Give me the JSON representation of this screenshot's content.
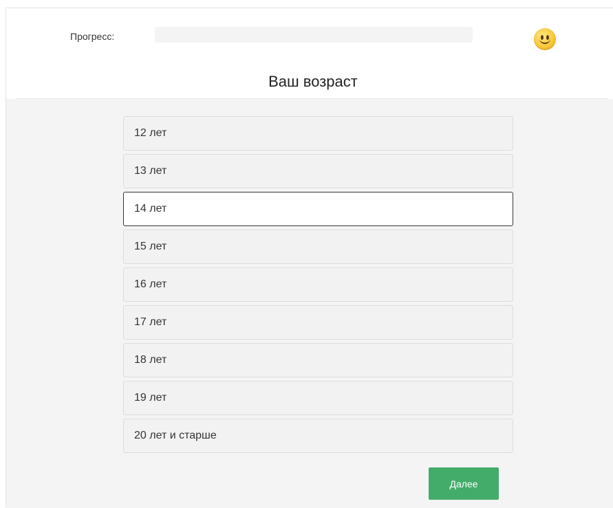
{
  "header": {
    "progress_label": "Прогресс:",
    "progress_value": 0,
    "status_icon": "smiley-face-icon"
  },
  "question": {
    "title": "Ваш возраст"
  },
  "options": [
    {
      "label": "12 лет",
      "selected": false
    },
    {
      "label": "13 лет",
      "selected": false
    },
    {
      "label": "14 лет",
      "selected": true
    },
    {
      "label": "15 лет",
      "selected": false
    },
    {
      "label": "16 лет",
      "selected": false
    },
    {
      "label": "17 лет",
      "selected": false
    },
    {
      "label": "18 лет",
      "selected": false
    },
    {
      "label": "19 лет",
      "selected": false
    },
    {
      "label": "20 лет и старше",
      "selected": false
    }
  ],
  "actions": {
    "next_label": "Далее"
  },
  "colors": {
    "accent": "#44ac6a",
    "page_background": "#f4f4f4",
    "selected_border": "#333333"
  }
}
